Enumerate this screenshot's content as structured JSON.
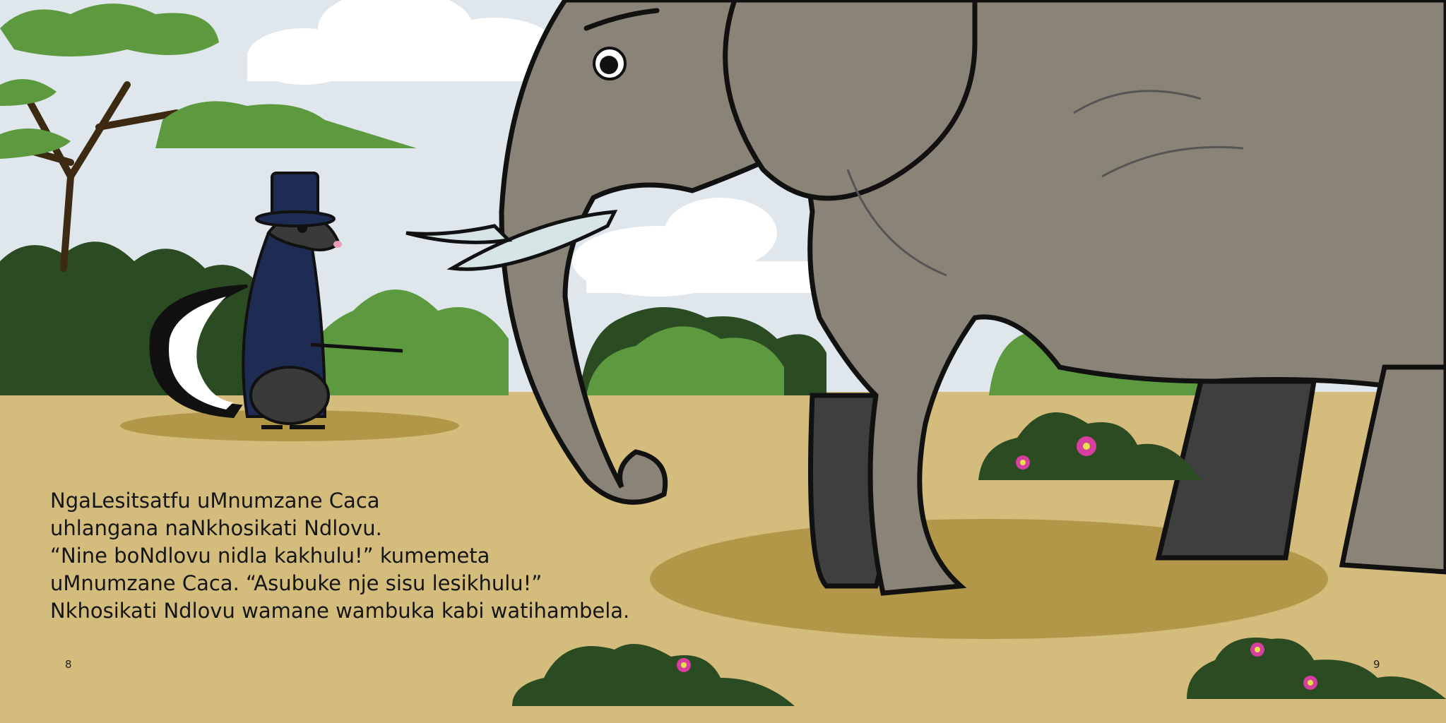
{
  "book": {
    "story_lines": [
      "NgaLesitsatfu uMnumzane Caca",
      "uhlangana naNkhosikati Ndlovu.",
      "“Nine boNdlovu nidla kakhulu!” kumemeta",
      "uMnumzane Caca. “Asubuke nje sisu lesikhulu!”",
      "Nkhosikati Ndlovu wamane wambuka kabi watihambela."
    ],
    "page_left": "8",
    "page_right": "9"
  },
  "colors": {
    "sky": "#dfe6ec",
    "ground": "#d4bd7c",
    "shadow": "#b39749",
    "bush_dark": "#2b4b22",
    "bush_light": "#5d9a3f",
    "elephant": "#8a8378",
    "elephant_dark": "#3f3f3f",
    "tusk": "#d7e4e6",
    "skunk_coat": "#1e2b52",
    "flower": "#d63fa0"
  }
}
